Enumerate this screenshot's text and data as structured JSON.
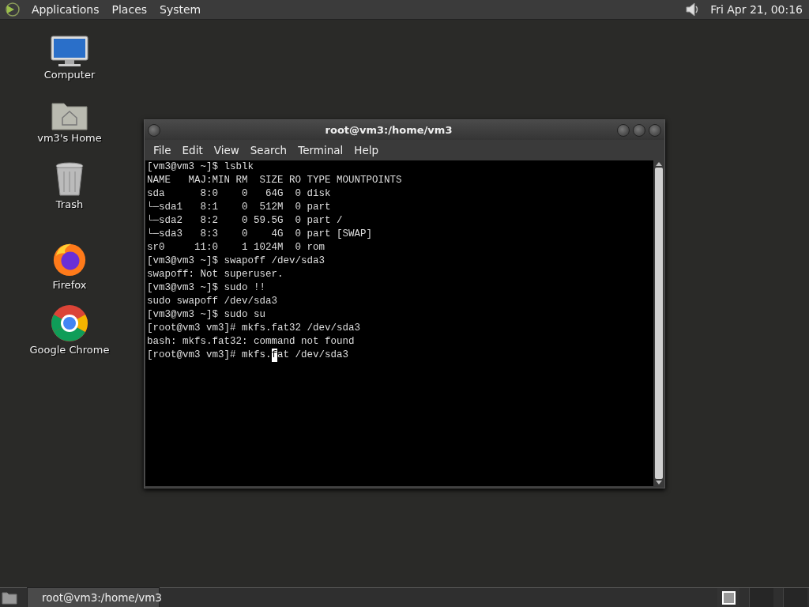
{
  "top_panel": {
    "menus": [
      "Applications",
      "Places",
      "System"
    ],
    "clock": "Fri Apr 21, 00:16"
  },
  "desktop_icons": [
    {
      "kind": "computer",
      "label": "Computer"
    },
    {
      "kind": "home",
      "label": "vm3's Home"
    },
    {
      "kind": "trash",
      "label": "Trash"
    },
    {
      "kind": "firefox",
      "label": "Firefox"
    },
    {
      "kind": "chrome",
      "label": "Google Chrome"
    }
  ],
  "window": {
    "title": "root@vm3:/home/vm3",
    "menu": [
      "File",
      "Edit",
      "View",
      "Search",
      "Terminal",
      "Help"
    ],
    "terminal_lines": [
      "[vm3@vm3 ~]$ lsblk",
      "NAME   MAJ:MIN RM  SIZE RO TYPE MOUNTPOINTS",
      "sda      8:0    0   64G  0 disk",
      "└─sda1   8:1    0  512M  0 part",
      "└─sda2   8:2    0 59.5G  0 part /",
      "└─sda3   8:3    0    4G  0 part [SWAP]",
      "sr0     11:0    1 1024M  0 rom",
      "[vm3@vm3 ~]$ swapoff /dev/sda3",
      "swapoff: Not superuser.",
      "[vm3@vm3 ~]$ sudo !!",
      "sudo swapoff /dev/sda3",
      "[vm3@vm3 ~]$ sudo su",
      "[root@vm3 vm3]# mkfs.fat32 /dev/sda3",
      "bash: mkfs.fat32: command not found"
    ],
    "prompt_line": {
      "before": "[root@vm3 vm3]# mkfs.",
      "cursor": "f",
      "after": "at /dev/sda3"
    }
  },
  "taskbar": {
    "tasks": [
      {
        "label": "root@vm3:/home/vm3",
        "selected": true
      }
    ]
  }
}
